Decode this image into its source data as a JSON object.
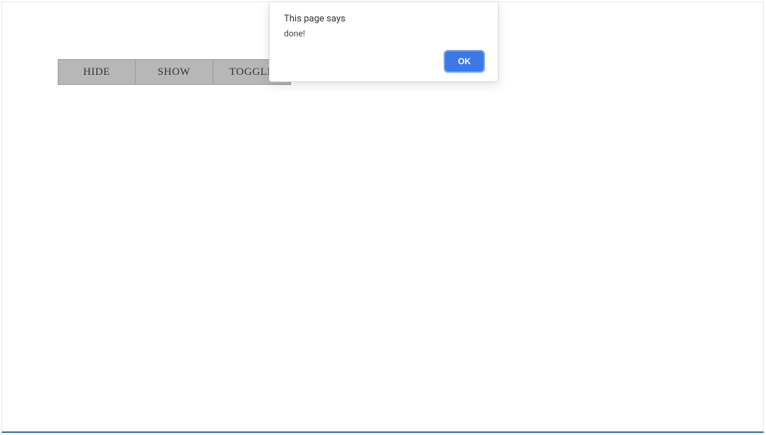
{
  "buttons": {
    "hide": "HIDE",
    "show": "SHOW",
    "toggle": "TOGGLE"
  },
  "alert": {
    "title": "This page says",
    "message": "done!",
    "ok": "OK"
  }
}
